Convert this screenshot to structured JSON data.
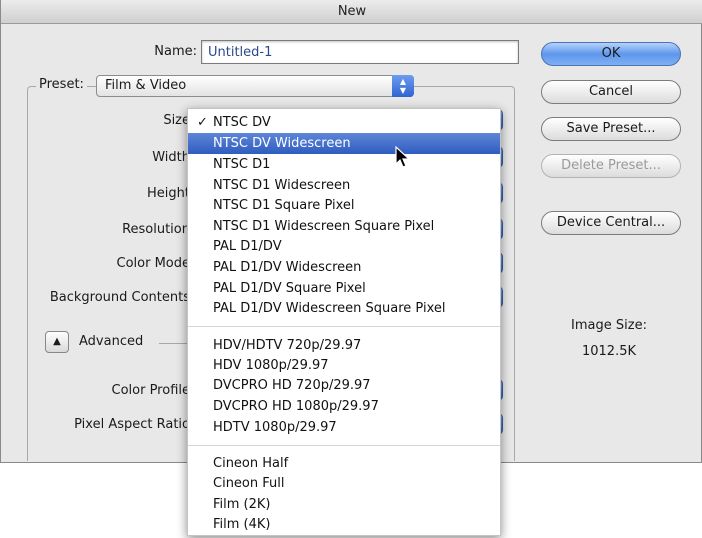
{
  "window": {
    "title": "New"
  },
  "form": {
    "name_label": "Name:",
    "name_value": "Untitled-1",
    "preset_label": "Preset:",
    "preset_value": "Film & Video",
    "labels": [
      "Size",
      "Width",
      "Height",
      "Resolution",
      "Color Mode",
      "Background Contents",
      "Color Profile",
      "Pixel Aspect Ratio"
    ],
    "advanced_label": "Advanced"
  },
  "buttons": {
    "ok": "OK",
    "cancel": "Cancel",
    "save_preset": "Save Preset...",
    "delete_preset": "Delete Preset...",
    "device_central": "Device Central..."
  },
  "image_size": {
    "label": "Image Size:",
    "value": "1012.5K"
  },
  "size_menu": {
    "checked_item": "NTSC DV",
    "highlighted_item": "NTSC DV Widescreen",
    "groups": [
      [
        "NTSC DV",
        "NTSC DV Widescreen",
        "NTSC D1",
        "NTSC D1 Widescreen",
        "NTSC D1 Square Pixel",
        "NTSC D1 Widescreen Square Pixel",
        "PAL D1/DV",
        "PAL D1/DV Widescreen",
        "PAL D1/DV Square Pixel",
        "PAL D1/DV Widescreen Square Pixel"
      ],
      [
        "HDV/HDTV 720p/29.97",
        "HDV 1080p/29.97",
        "DVCPRO HD 720p/29.97",
        "DVCPRO HD 1080p/29.97",
        "HDTV 1080p/29.97"
      ],
      [
        "Cineon Half",
        "Cineon Full",
        "Film (2K)",
        "Film (4K)"
      ]
    ]
  },
  "icons": {
    "checkmark": "checkmark-icon",
    "cursor": "arrow-cursor-icon",
    "disclosure": "disclosure-triangle-icon",
    "stepper": "popup-stepper-icon"
  }
}
